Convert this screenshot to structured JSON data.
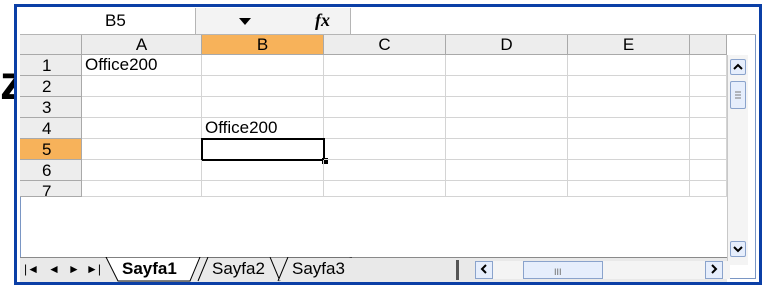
{
  "name_box": {
    "value": "B5"
  },
  "formula_bar": {
    "fx_label": "fx",
    "value": ""
  },
  "columns": [
    "A",
    "B",
    "C",
    "D",
    "E"
  ],
  "selected_column": "B",
  "rows": [
    "1",
    "2",
    "3",
    "4",
    "5",
    "6",
    "7"
  ],
  "selected_row": "5",
  "cells": {
    "A1": "Office200",
    "B4": "Office200"
  },
  "left_glyph": "z",
  "sheet_nav": {
    "first": "|◄",
    "prev": "◄",
    "next": "►",
    "last": "►|"
  },
  "sheets": [
    "Sayfa1",
    "Sayfa2",
    "Sayfa3"
  ],
  "active_sheet": "Sayfa1",
  "scroll_grip": "III",
  "colors": {
    "frame": "#0b3fa6",
    "selection_header": "#f7b25a"
  }
}
